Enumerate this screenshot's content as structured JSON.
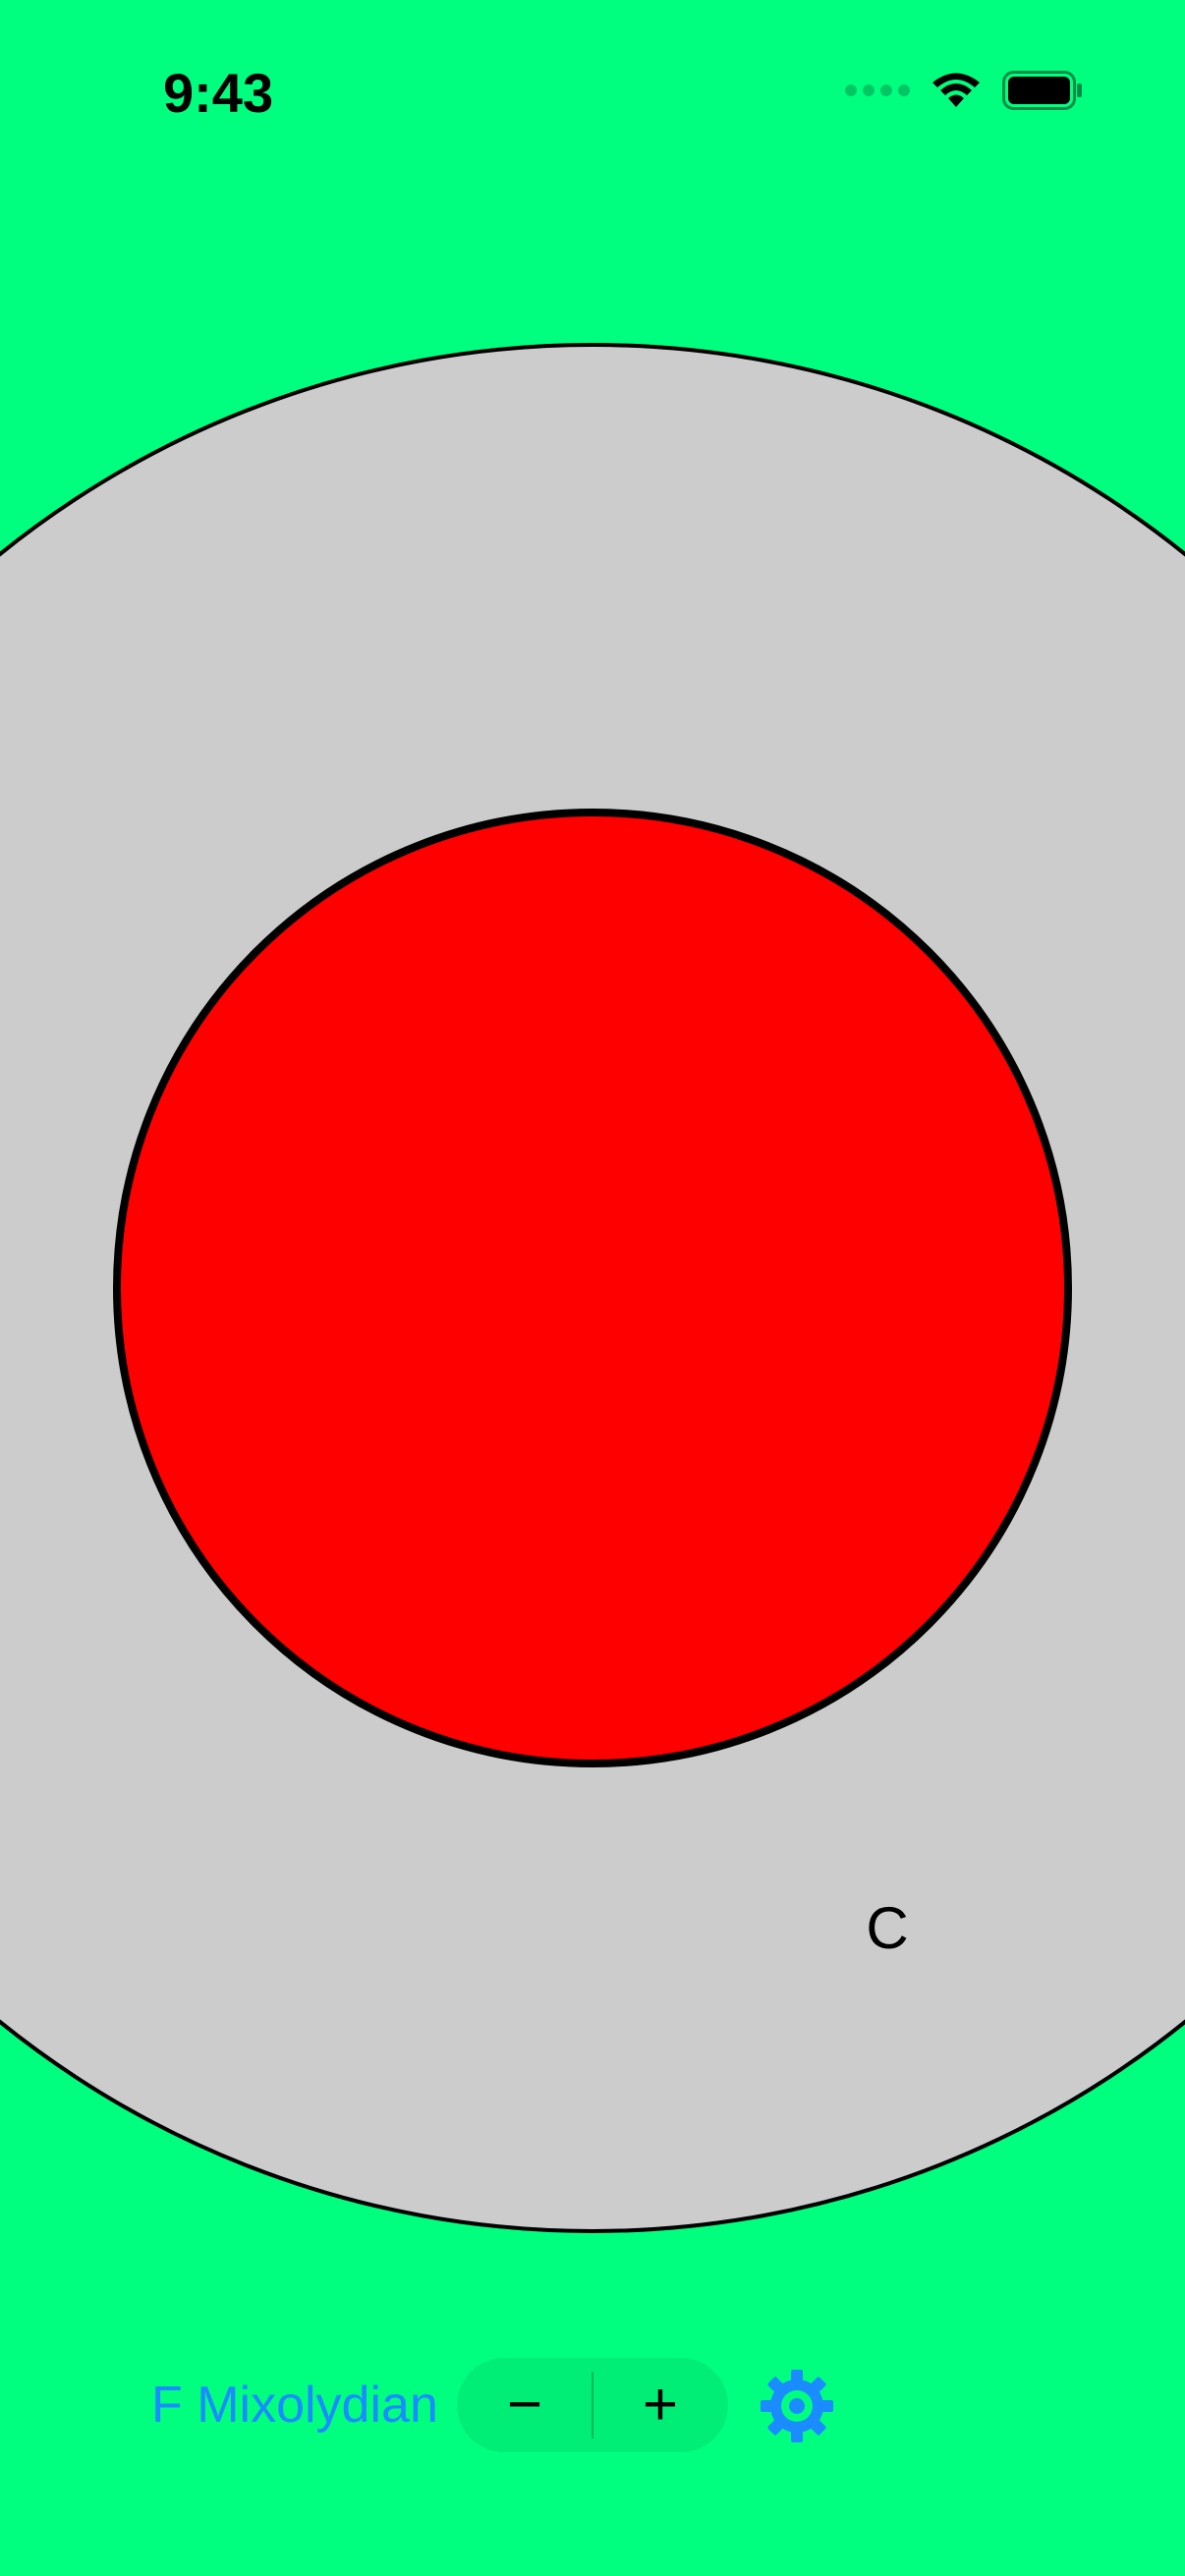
{
  "status_bar": {
    "time": "9:43",
    "icons": [
      "cellular-signal-icon",
      "wifi-icon",
      "battery-icon"
    ]
  },
  "wheel": {
    "outer_ring_color": "#CCCCCC",
    "center_color": "#FF0000",
    "background_color": "#00FF7F",
    "note_label": "C"
  },
  "toolbar": {
    "scale_name": "F Mixolydian",
    "decrement_label": "−",
    "increment_label": "+",
    "settings_icon": "gear-icon",
    "accent_color": "#1A8CFF"
  }
}
